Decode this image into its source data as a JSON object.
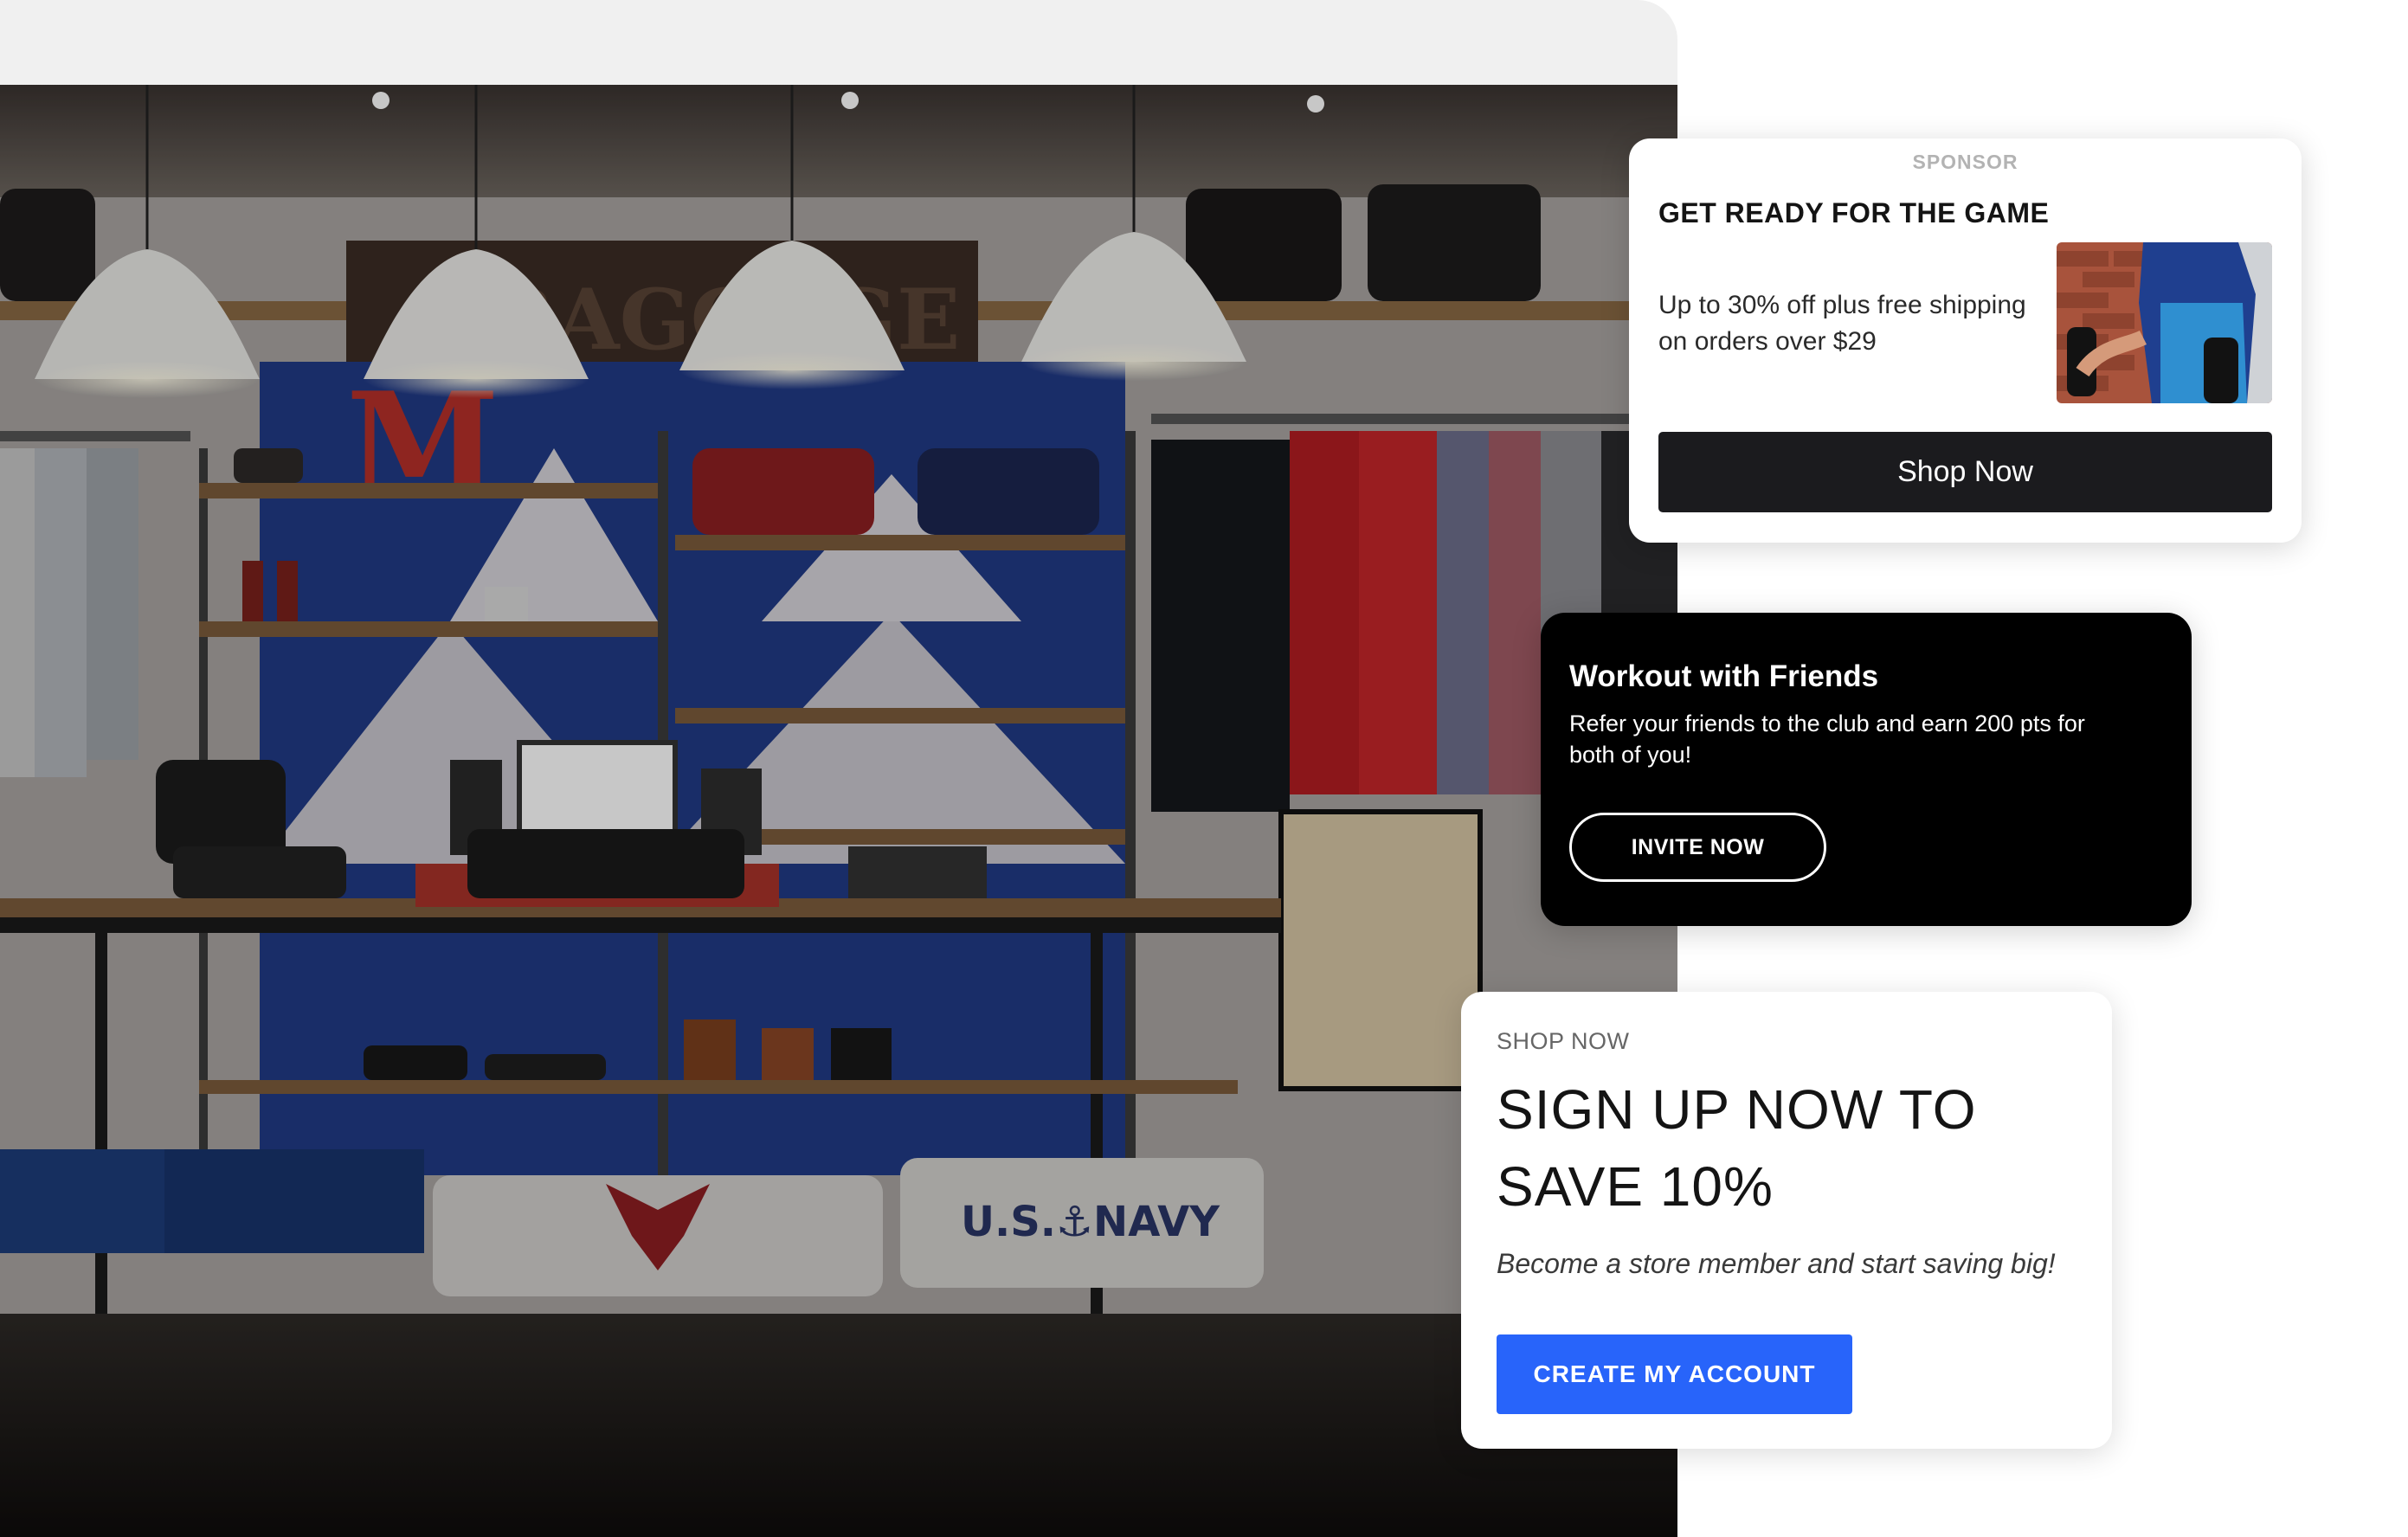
{
  "sponsor_card": {
    "label": "SPONSOR",
    "title": "GET READY FOR THE GAME",
    "description": "Up to 30% off plus free shipping on orders over $29",
    "button_label": "Shop Now",
    "button_color": "#1b1b1e"
  },
  "workout_card": {
    "title": "Workout with Friends",
    "description": "Refer your friends to the club and earn 200 pts for both of you!",
    "button_label": "INVITE NOW",
    "background_color": "#000000"
  },
  "signup_card": {
    "eyebrow": "SHOP NOW",
    "title": "SIGN UP NOW TO SAVE 10%",
    "description": "Become a store member and start saving big!",
    "button_label": "CREATE MY ACCOUNT",
    "button_color": "#2864fa"
  },
  "store_photo": {
    "sign_text": "BAGGAGE",
    "letter_sign": "M",
    "sweatshirt_text": "U.S.⚓NAVY"
  }
}
